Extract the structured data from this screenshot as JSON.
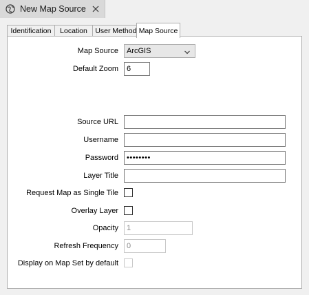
{
  "window": {
    "tab_title": "New Map Source"
  },
  "tabs": [
    {
      "label": "Identification"
    },
    {
      "label": "Location"
    },
    {
      "label": "User Methods"
    },
    {
      "label": "Map Source"
    }
  ],
  "form": {
    "map_source": {
      "label": "Map Source",
      "value": "ArcGIS"
    },
    "default_zoom": {
      "label": "Default Zoom",
      "value": "6"
    },
    "source_url": {
      "label": "Source URL",
      "value": ""
    },
    "username": {
      "label": "Username",
      "value": ""
    },
    "password": {
      "label": "Password",
      "value": "••••••••"
    },
    "layer_title": {
      "label": "Layer Title",
      "value": ""
    },
    "single_tile": {
      "label": "Request Map as Single Tile",
      "checked": false
    },
    "overlay_layer": {
      "label": "Overlay Layer",
      "checked": false
    },
    "opacity": {
      "label": "Opacity",
      "value": "1"
    },
    "refresh_frequency": {
      "label": "Refresh Frequency",
      "value": "0"
    },
    "display_default": {
      "label": "Display on Map Set by default",
      "checked": false
    }
  },
  "icons": {
    "tab_icon": "globe-icon",
    "close": "close-icon",
    "dropdown": "chevron-down-icon"
  },
  "colors": {
    "panel_bg": "#f0f0f0",
    "page_bg": "#ffffff",
    "border": "#adadad",
    "disabled_text": "#8a8a8a"
  }
}
